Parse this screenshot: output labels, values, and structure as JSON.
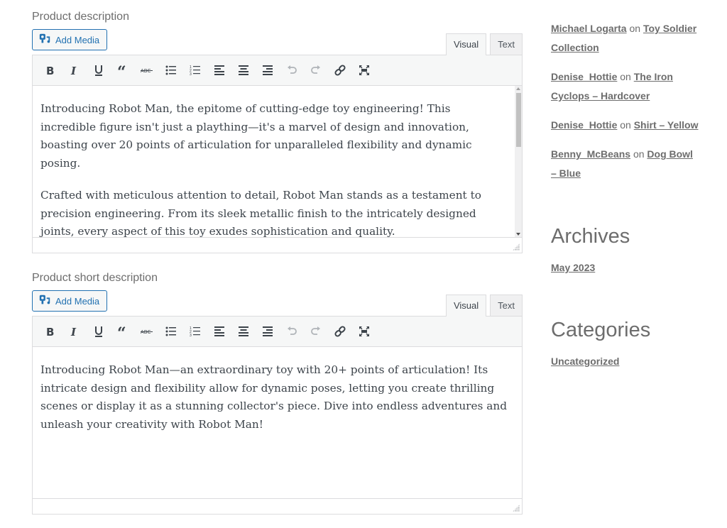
{
  "editors": [
    {
      "label": "Product description",
      "add_media_label": "Add Media",
      "tabs": [
        "Visual",
        "Text"
      ],
      "active_tab": "Visual",
      "paragraphs": [
        "Introducing Robot Man, the epitome of cutting-edge toy engineering! This incredible figure isn't just a plaything—it's a marvel of design and innovation, boasting over 20 points of articulation for unparalleled flexibility and dynamic posing.",
        "Crafted with meticulous attention to detail, Robot Man stands as a testament to precision engineering. From its sleek metallic finish to the intricately designed joints, every aspect of this toy exudes sophistication and quality."
      ]
    },
    {
      "label": "Product short description",
      "add_media_label": "Add Media",
      "tabs": [
        "Visual",
        "Text"
      ],
      "active_tab": "Visual",
      "paragraphs": [
        "Introducing Robot Man—an extraordinary toy with 20+ points of articulation! Its intricate design and flexibility allow for dynamic poses, letting you create thrilling scenes or display it as a stunning collector's piece. Dive into endless adventures and unleash your creativity with Robot Man!"
      ]
    }
  ],
  "toolbar": [
    {
      "name": "bold",
      "icon": "bold-icon"
    },
    {
      "name": "italic",
      "icon": "italic-icon"
    },
    {
      "name": "underline",
      "icon": "underline-icon"
    },
    {
      "name": "blockquote",
      "icon": "blockquote-icon"
    },
    {
      "name": "strikethrough",
      "icon": "strikethrough-icon"
    },
    {
      "name": "bullet-list",
      "icon": "bullet-list-icon"
    },
    {
      "name": "numbered-list",
      "icon": "numbered-list-icon"
    },
    {
      "name": "align-left",
      "icon": "align-left-icon"
    },
    {
      "name": "align-center",
      "icon": "align-center-icon"
    },
    {
      "name": "align-right",
      "icon": "align-right-icon"
    },
    {
      "name": "undo",
      "icon": "undo-icon",
      "disabled": true
    },
    {
      "name": "redo",
      "icon": "redo-icon",
      "disabled": true
    },
    {
      "name": "link",
      "icon": "link-icon"
    },
    {
      "name": "fullscreen",
      "icon": "fullscreen-icon"
    }
  ],
  "sidebar": {
    "comments": [
      {
        "author": "Michael Logarta",
        "connector": "on",
        "post": "Toy Soldier Collection"
      },
      {
        "author": "Denise_Hottie",
        "connector": "on",
        "post": "The Iron Cyclops – Hardcover"
      },
      {
        "author": "Denise_Hottie",
        "connector": "on",
        "post": "Shirt – Yellow"
      },
      {
        "author": "Benny_McBeans",
        "connector": "on",
        "post": "Dog Bowl – Blue"
      }
    ],
    "archives": {
      "title": "Archives",
      "items": [
        "May 2023"
      ]
    },
    "categories": {
      "title": "Categories",
      "items": [
        "Uncategorized"
      ]
    }
  }
}
